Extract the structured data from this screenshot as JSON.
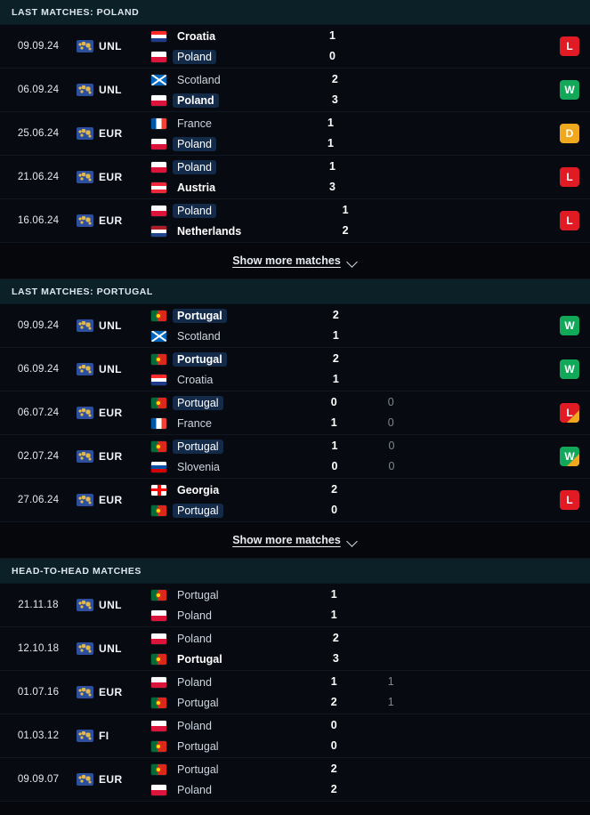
{
  "sections": [
    {
      "id": "last-matches-poland",
      "title": "LAST MATCHES: POLAND",
      "has_badge": true,
      "show_more": {
        "label": "Show more matches",
        "icon": "chevron-down-icon"
      },
      "matches": [
        {
          "date": "09.09.24",
          "competition": "UNL",
          "competition_icon": "world-map-icon",
          "home": {
            "name": "Croatia",
            "flag": "croatia",
            "bold": true,
            "highlight": false
          },
          "away": {
            "name": "Poland",
            "flag": "poland",
            "bold": false,
            "highlight": true
          },
          "score_home": "1",
          "score_away": "0",
          "score2_home": "",
          "score2_away": "",
          "result": "L",
          "result_penalty": false
        },
        {
          "date": "06.09.24",
          "competition": "UNL",
          "competition_icon": "world-map-icon",
          "home": {
            "name": "Scotland",
            "flag": "scotland",
            "bold": false,
            "highlight": false
          },
          "away": {
            "name": "Poland",
            "flag": "poland",
            "bold": true,
            "highlight": true
          },
          "score_home": "2",
          "score_away": "3",
          "score2_home": "",
          "score2_away": "",
          "result": "W",
          "result_penalty": false
        },
        {
          "date": "25.06.24",
          "competition": "EUR",
          "competition_icon": "world-map-icon",
          "home": {
            "name": "France",
            "flag": "france",
            "bold": false,
            "highlight": false
          },
          "away": {
            "name": "Poland",
            "flag": "poland",
            "bold": false,
            "highlight": true
          },
          "score_home": "1",
          "score_away": "1",
          "score2_home": "",
          "score2_away": "",
          "result": "D",
          "result_penalty": false
        },
        {
          "date": "21.06.24",
          "competition": "EUR",
          "competition_icon": "world-map-icon",
          "home": {
            "name": "Poland",
            "flag": "poland",
            "bold": false,
            "highlight": true
          },
          "away": {
            "name": "Austria",
            "flag": "austria",
            "bold": true,
            "highlight": false
          },
          "score_home": "1",
          "score_away": "3",
          "score2_home": "",
          "score2_away": "",
          "result": "L",
          "result_penalty": false
        },
        {
          "date": "16.06.24",
          "competition": "EUR",
          "competition_icon": "world-map-icon",
          "home": {
            "name": "Poland",
            "flag": "poland",
            "bold": false,
            "highlight": true
          },
          "away": {
            "name": "Netherlands",
            "flag": "netherlands",
            "bold": true,
            "highlight": false
          },
          "score_home": "1",
          "score_away": "2",
          "score2_home": "",
          "score2_away": "",
          "result": "L",
          "result_penalty": false
        }
      ]
    },
    {
      "id": "last-matches-portugal",
      "title": "LAST MATCHES: PORTUGAL",
      "has_badge": true,
      "show_more": {
        "label": "Show more matches",
        "icon": "chevron-down-icon"
      },
      "matches": [
        {
          "date": "09.09.24",
          "competition": "UNL",
          "competition_icon": "world-map-icon",
          "home": {
            "name": "Portugal",
            "flag": "portugal",
            "bold": true,
            "highlight": true
          },
          "away": {
            "name": "Scotland",
            "flag": "scotland",
            "bold": false,
            "highlight": false
          },
          "score_home": "2",
          "score_away": "1",
          "score2_home": "",
          "score2_away": "",
          "result": "W",
          "result_penalty": false
        },
        {
          "date": "06.09.24",
          "competition": "UNL",
          "competition_icon": "world-map-icon",
          "home": {
            "name": "Portugal",
            "flag": "portugal",
            "bold": true,
            "highlight": true
          },
          "away": {
            "name": "Croatia",
            "flag": "croatia",
            "bold": false,
            "highlight": false
          },
          "score_home": "2",
          "score_away": "1",
          "score2_home": "",
          "score2_away": "",
          "result": "W",
          "result_penalty": false
        },
        {
          "date": "06.07.24",
          "competition": "EUR",
          "competition_icon": "world-map-icon",
          "home": {
            "name": "Portugal",
            "flag": "portugal",
            "bold": false,
            "highlight": true
          },
          "away": {
            "name": "France",
            "flag": "france",
            "bold": false,
            "highlight": false
          },
          "score_home": "0",
          "score_away": "1",
          "score2_home": "0",
          "score2_away": "0",
          "result": "L",
          "result_penalty": true
        },
        {
          "date": "02.07.24",
          "competition": "EUR",
          "competition_icon": "world-map-icon",
          "home": {
            "name": "Portugal",
            "flag": "portugal",
            "bold": false,
            "highlight": true
          },
          "away": {
            "name": "Slovenia",
            "flag": "slovenia",
            "bold": false,
            "highlight": false
          },
          "score_home": "1",
          "score_away": "0",
          "score2_home": "0",
          "score2_away": "0",
          "result": "W",
          "result_penalty": true
        },
        {
          "date": "27.06.24",
          "competition": "EUR",
          "competition_icon": "world-map-icon",
          "home": {
            "name": "Georgia",
            "flag": "georgia",
            "bold": true,
            "highlight": false
          },
          "away": {
            "name": "Portugal",
            "flag": "portugal",
            "bold": false,
            "highlight": true
          },
          "score_home": "2",
          "score_away": "0",
          "score2_home": "",
          "score2_away": "",
          "result": "L",
          "result_penalty": false
        }
      ]
    },
    {
      "id": "head-to-head-matches",
      "title": "HEAD-TO-HEAD MATCHES",
      "has_badge": false,
      "show_more": null,
      "matches": [
        {
          "date": "21.11.18",
          "competition": "UNL",
          "competition_icon": "world-map-icon",
          "home": {
            "name": "Portugal",
            "flag": "portugal",
            "bold": false,
            "highlight": false
          },
          "away": {
            "name": "Poland",
            "flag": "poland",
            "bold": false,
            "highlight": false
          },
          "score_home": "1",
          "score_away": "1",
          "score2_home": "",
          "score2_away": "",
          "result": "",
          "result_penalty": false
        },
        {
          "date": "12.10.18",
          "competition": "UNL",
          "competition_icon": "world-map-icon",
          "home": {
            "name": "Poland",
            "flag": "poland",
            "bold": false,
            "highlight": false
          },
          "away": {
            "name": "Portugal",
            "flag": "portugal",
            "bold": true,
            "highlight": false
          },
          "score_home": "2",
          "score_away": "3",
          "score2_home": "",
          "score2_away": "",
          "result": "",
          "result_penalty": false
        },
        {
          "date": "01.07.16",
          "competition": "EUR",
          "competition_icon": "world-map-icon",
          "home": {
            "name": "Poland",
            "flag": "poland",
            "bold": false,
            "highlight": false
          },
          "away": {
            "name": "Portugal",
            "flag": "portugal",
            "bold": false,
            "highlight": false
          },
          "score_home": "1",
          "score_away": "2",
          "score2_home": "1",
          "score2_away": "1",
          "result": "",
          "result_penalty": false
        },
        {
          "date": "01.03.12",
          "competition": "FI",
          "competition_icon": "world-map-icon",
          "home": {
            "name": "Poland",
            "flag": "poland",
            "bold": false,
            "highlight": false
          },
          "away": {
            "name": "Portugal",
            "flag": "portugal",
            "bold": false,
            "highlight": false
          },
          "score_home": "0",
          "score_away": "0",
          "score2_home": "",
          "score2_away": "",
          "result": "",
          "result_penalty": false
        },
        {
          "date": "09.09.07",
          "competition": "EUR",
          "competition_icon": "world-map-icon",
          "home": {
            "name": "Portugal",
            "flag": "portugal",
            "bold": false,
            "highlight": false
          },
          "away": {
            "name": "Poland",
            "flag": "poland",
            "bold": false,
            "highlight": false
          },
          "score_home": "2",
          "score_away": "2",
          "score2_home": "",
          "score2_away": "",
          "result": "",
          "result_penalty": false
        }
      ]
    }
  ],
  "colors": {
    "win": "#11a85a",
    "loss": "#e01b24",
    "draw": "#f0a81e",
    "section_header_bg": "#0c2028",
    "highlight_bg": "#132a49"
  }
}
